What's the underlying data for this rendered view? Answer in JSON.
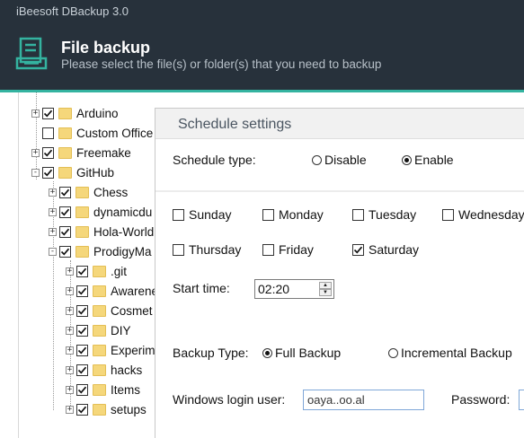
{
  "app": {
    "title": "iBeesoft DBackup 3.0"
  },
  "header": {
    "title": "File backup",
    "subtitle": "Please select the file(s) or folder(s) that you need to backup",
    "icon": "file-backup-icon",
    "accent": "#34b3a0",
    "background": "#27313b"
  },
  "tree": {
    "items": [
      {
        "label": "Arduino",
        "checked": true,
        "expander": "+"
      },
      {
        "label": "Custom Office",
        "checked": false,
        "expander": ""
      },
      {
        "label": "Freemake",
        "checked": true,
        "expander": "+"
      },
      {
        "label": "GitHub",
        "checked": true,
        "expander": "-"
      },
      {
        "label": "Chess",
        "checked": true,
        "expander": "+"
      },
      {
        "label": "dynamicdu",
        "checked": true,
        "expander": "+"
      },
      {
        "label": "Hola-World",
        "checked": true,
        "expander": "+"
      },
      {
        "label": "ProdigyMa",
        "checked": true,
        "expander": "-"
      },
      {
        "label": ".git",
        "checked": true,
        "expander": "+"
      },
      {
        "label": "Awarenes",
        "checked": true,
        "expander": "+"
      },
      {
        "label": "Cosmet",
        "checked": true,
        "expander": "+"
      },
      {
        "label": "DIY",
        "checked": true,
        "expander": "+"
      },
      {
        "label": "Experim",
        "checked": true,
        "expander": "+"
      },
      {
        "label": "hacks",
        "checked": true,
        "expander": "+"
      },
      {
        "label": "Items",
        "checked": true,
        "expander": "+"
      },
      {
        "label": "setups",
        "checked": true,
        "expander": "+"
      }
    ]
  },
  "schedule": {
    "title": "Schedule settings",
    "type_label": "Schedule type:",
    "type_options": [
      {
        "label": "Disable",
        "selected": false
      },
      {
        "label": "Enable",
        "selected": true
      }
    ],
    "days": [
      {
        "label": "Sunday",
        "checked": false
      },
      {
        "label": "Monday",
        "checked": false
      },
      {
        "label": "Tuesday",
        "checked": false
      },
      {
        "label": "Wednesday",
        "checked": false
      },
      {
        "label": "Thursday",
        "checked": false
      },
      {
        "label": "Friday",
        "checked": false
      },
      {
        "label": "Saturday",
        "checked": true
      }
    ],
    "start_time_label": "Start time:",
    "start_time": "02:20",
    "backup_type_label": "Backup Type:",
    "backup_types": [
      {
        "label": "Full Backup",
        "selected": true
      },
      {
        "label": "Incremental Backup",
        "selected": false
      }
    ],
    "login_user_label": "Windows login user:",
    "login_user": "oaya..oo.al",
    "password_label": "Password:"
  }
}
